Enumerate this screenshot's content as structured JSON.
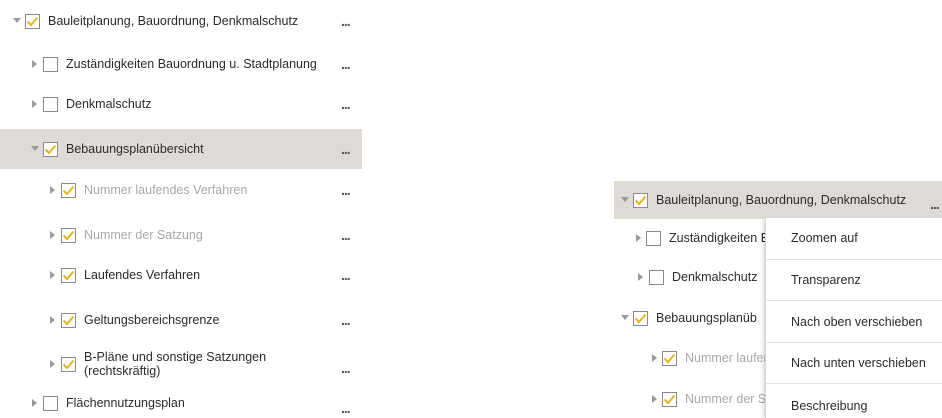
{
  "colors": {
    "check": "#e6b41f",
    "selected_row": "#dedbd6"
  },
  "left_tree": {
    "items": [
      {
        "label": "Bauleitplanung, Bauordnung, Denkmalschutz",
        "checked": true,
        "expanded": true,
        "actions_label": "..."
      },
      {
        "label": "Zuständigkeiten Bauordnung u. Stadtplanung",
        "checked": false,
        "expanded": false,
        "actions_label": "..."
      },
      {
        "label": "Denkmalschutz",
        "checked": false,
        "expanded": false,
        "actions_label": "..."
      },
      {
        "label": "Bebauungsplanübersicht",
        "checked": true,
        "expanded": true,
        "selected": true,
        "actions_label": "..."
      },
      {
        "label": "Nummer laufendes Verfahren",
        "checked": true,
        "expanded": false,
        "dimmed": true,
        "actions_label": "..."
      },
      {
        "label": "Nummer der Satzung",
        "checked": true,
        "expanded": false,
        "dimmed": true,
        "actions_label": "..."
      },
      {
        "label": "Laufendes Verfahren",
        "checked": true,
        "expanded": false,
        "actions_label": "..."
      },
      {
        "label": "Geltungsbereichsgrenze",
        "checked": true,
        "expanded": false,
        "actions_label": "..."
      },
      {
        "label": "B-Pläne und sonstige Satzungen (rechtskräftig)",
        "checked": true,
        "expanded": false,
        "actions_label": "..."
      },
      {
        "label": "Flächennutzungsplan",
        "checked": false,
        "expanded": false,
        "actions_label": "..."
      }
    ]
  },
  "right_tree": {
    "items": [
      {
        "label": "Bauleitplanung, Bauordnung, Denkmalschutz",
        "checked": true,
        "expanded": true,
        "selected": true,
        "actions_label": "..."
      },
      {
        "label": "Zuständigkeiten E",
        "checked": false,
        "expanded": false
      },
      {
        "label": "Denkmalschutz",
        "checked": false,
        "expanded": false
      },
      {
        "label": "Bebauungsplanüb",
        "checked": true,
        "expanded": true
      },
      {
        "label": "Nummer laufer",
        "checked": true,
        "expanded": false,
        "dimmed": true
      },
      {
        "label": "Nummer der Sa",
        "checked": true,
        "expanded": false,
        "dimmed": true
      }
    ]
  },
  "context_menu": {
    "items": [
      "Zoomen auf",
      "Transparenz",
      "Nach oben verschieben",
      "Nach unten verschieben",
      "Beschreibung"
    ]
  }
}
